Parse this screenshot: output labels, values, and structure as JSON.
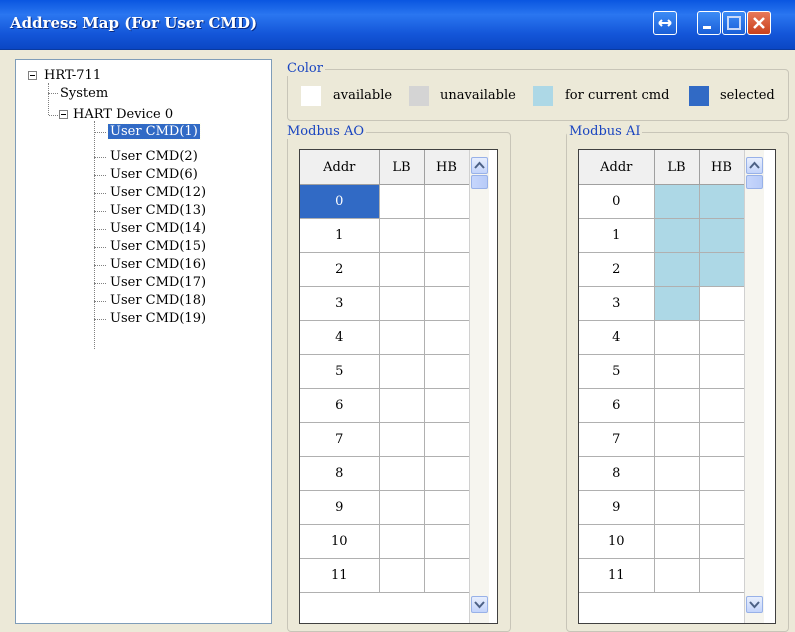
{
  "window": {
    "title": "Address Map (For User CMD)",
    "buttons": [
      "restore-size",
      "minimize",
      "maximize",
      "close"
    ]
  },
  "tree": {
    "root": "HRT-711",
    "system": "System",
    "device": "HART Device 0",
    "commands": [
      "User CMD(1)",
      "User CMD(2)",
      "User CMD(6)",
      "User CMD(12)",
      "User CMD(13)",
      "User CMD(14)",
      "User CMD(15)",
      "User CMD(16)",
      "User CMD(17)",
      "User CMD(18)",
      "User CMD(19)"
    ],
    "selected": "User CMD(1)"
  },
  "color_legend": {
    "title": "Color",
    "items": [
      {
        "label": "available",
        "color": "#ffffff"
      },
      {
        "label": "unavailable",
        "color": "#d4d4d4"
      },
      {
        "label": "for current cmd",
        "color": "#add8e6"
      },
      {
        "label": "selected",
        "color": "#316ac5"
      }
    ]
  },
  "modbus_ao": {
    "title": "Modbus AO",
    "columns": [
      "Addr",
      "LB",
      "HB"
    ],
    "rows": [
      "0",
      "1",
      "2",
      "3",
      "4",
      "5",
      "6",
      "7",
      "8",
      "9",
      "10",
      "11"
    ],
    "selected_row": "0"
  },
  "modbus_ai": {
    "title": "Modbus AI",
    "columns": [
      "Addr",
      "LB",
      "HB"
    ],
    "rows": [
      "0",
      "1",
      "2",
      "3",
      "4",
      "5",
      "6",
      "7",
      "8",
      "9",
      "10",
      "11"
    ],
    "current_cmd_cells": [
      {
        "row": "0",
        "cols": [
          "LB",
          "HB"
        ]
      },
      {
        "row": "1",
        "cols": [
          "LB",
          "HB"
        ]
      },
      {
        "row": "2",
        "cols": [
          "LB",
          "HB"
        ]
      },
      {
        "row": "3",
        "cols": [
          "LB"
        ]
      }
    ]
  }
}
